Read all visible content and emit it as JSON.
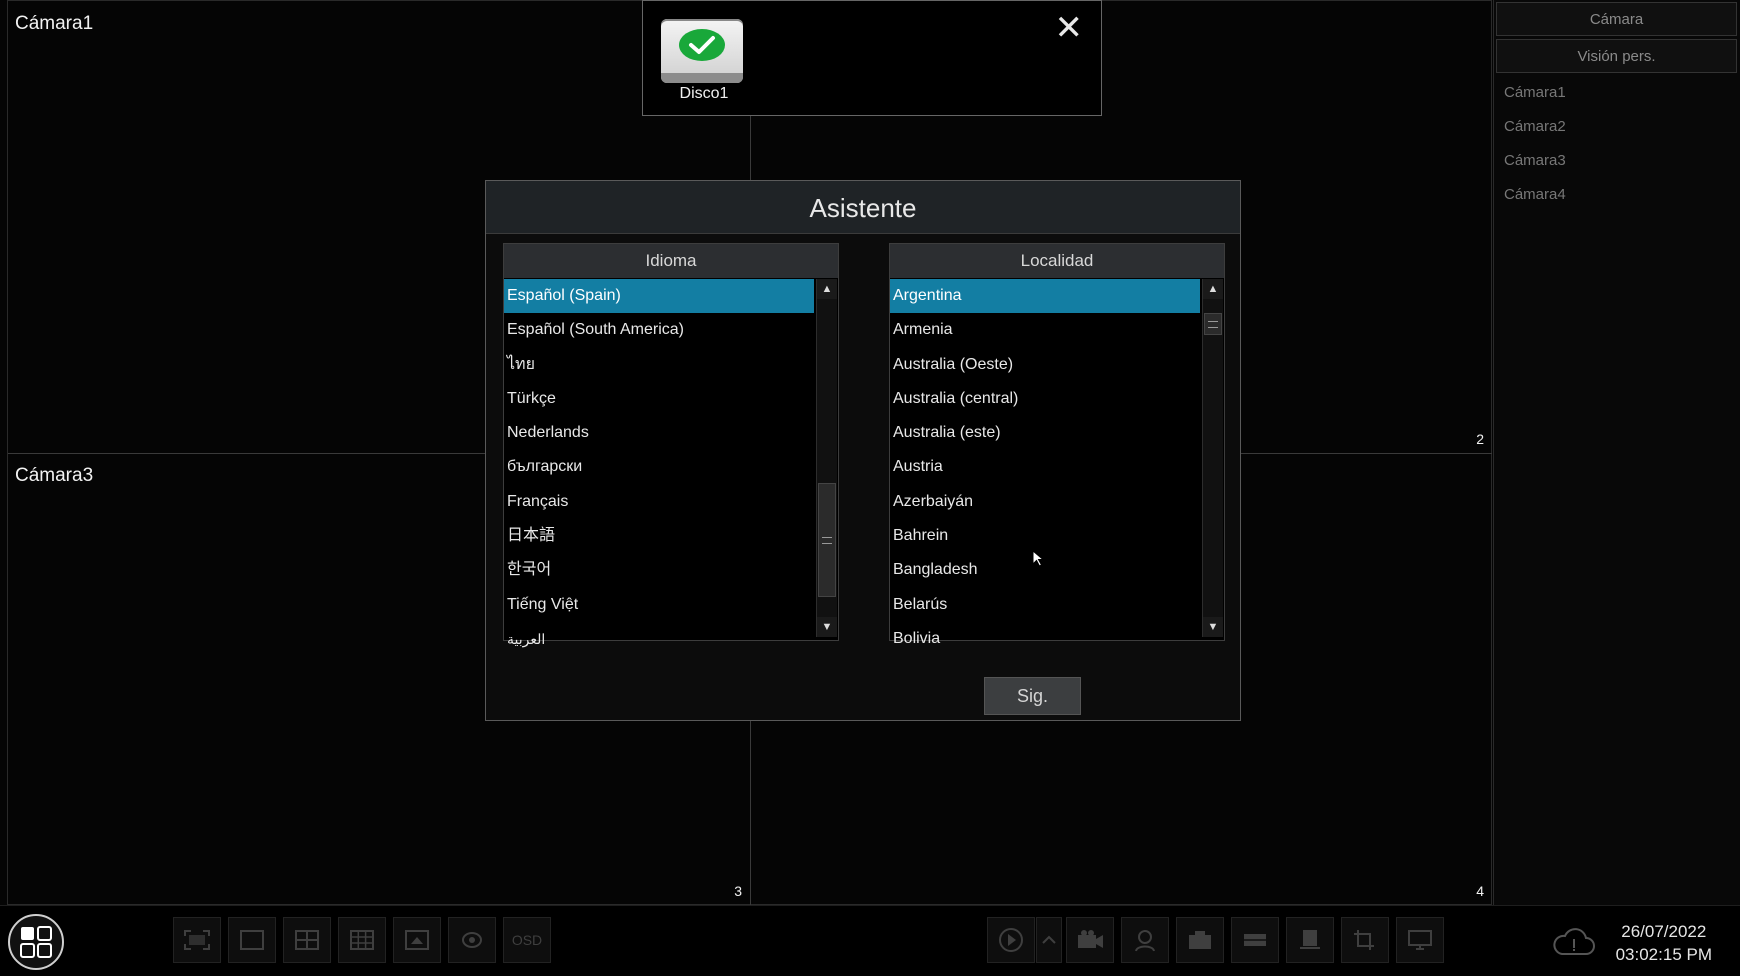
{
  "cameras": {
    "cell1_title": "Cámara1",
    "cell3_title": "Cámara3",
    "cell2_number": "2",
    "cell3_number": "3",
    "cell4_number": "4"
  },
  "sidebar": {
    "tab_camera": "Cámara",
    "tab_custom_view": "Visión pers.",
    "items": [
      "Cámara1",
      "Cámara2",
      "Cámara3",
      "Cámara4"
    ]
  },
  "disk_popup": {
    "disk_label": "Disco1",
    "close_symbol": "✕"
  },
  "wizard": {
    "title": "Asistente",
    "language_header": "Idioma",
    "locale_header": "Localidad",
    "languages": [
      "Español (Spain)",
      "Español (South America)",
      "ไทย",
      "Türkçe",
      "Nederlands",
      "български",
      "Français",
      "日本語",
      "한국어",
      "Tiếng Việt",
      "العربية"
    ],
    "selected_language": "Español (Spain)",
    "locales": [
      "Argentina",
      "Armenia",
      "Australia (Oeste)",
      "Australia (central)",
      "Australia (este)",
      "Austria",
      "Azerbaiyán",
      "Bahrein",
      "Bangladesh",
      "Belarús",
      "Bolivia"
    ],
    "selected_locale": "Argentina",
    "next_label": "Sig."
  },
  "toolbar": {
    "osd_label": "OSD",
    "date": "26/07/2022",
    "time": "03:02:15 PM"
  },
  "colors": {
    "selection": "#137ea3",
    "check_green": "#19a83a"
  }
}
